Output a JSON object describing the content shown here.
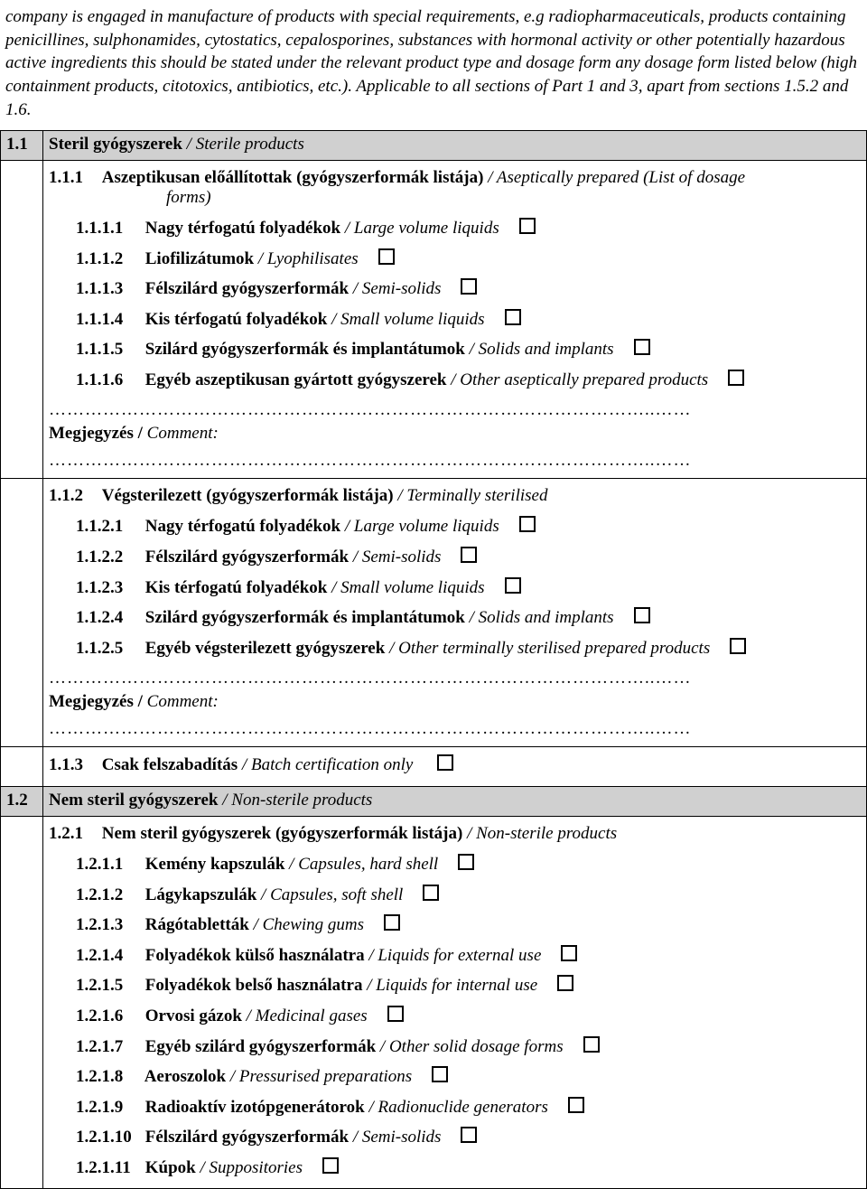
{
  "intro": "company is engaged in manufacture of products with special requirements, e.g radiopharmaceuticals, products containing penicillines, sulphonamides, cytostatics, cepalosporines, substances with hormonal activity or other potentially hazardous active ingredients this should be stated under the relevant product type and dosage form any dosage form listed below (high containment products, citotoxics, antibiotics, etc.). Applicable to all sections of Part 1 and 3, apart from sections 1.5.2 and 1.6.",
  "dots": "………………………………………………………………………………………..……",
  "comment": {
    "hu": "Megjegyzés",
    "sep": " / ",
    "en": "Comment:"
  },
  "s11": {
    "num": "1.1",
    "title_hu": "Steril gyógyszerek",
    "title_en": "Sterile products",
    "sep": " / ",
    "g111": {
      "num": "1.1.1",
      "title_hu": "Aszeptikusan előállítottak (gyógyszerformák listája)",
      "title_en_a": "Aseptically prepared (List of dosage",
      "title_en_b": "forms)",
      "items": [
        {
          "n": "1.1.1.1",
          "hu": "Nagy térfogatú folyadékok",
          "en": "Large volume liquids"
        },
        {
          "n": "1.1.1.2",
          "hu": "Liofilizátumok",
          "en": "Lyophilisates"
        },
        {
          "n": "1.1.1.3",
          "hu": "Félszilárd gyógyszerformák",
          "en": "Semi-solids"
        },
        {
          "n": "1.1.1.4",
          "hu": "Kis térfogatú folyadékok",
          "en": "Small volume liquids"
        },
        {
          "n": "1.1.1.5",
          "hu": "Szilárd gyógyszerformák és implantátumok",
          "en": "Solids and implants"
        },
        {
          "n": "1.1.1.6",
          "hu": "Egyéb aszeptikusan gyártott gyógyszerek",
          "en": "Other aseptically prepared products"
        }
      ]
    },
    "g112": {
      "num": "1.1.2",
      "title_hu": "Végsterilezett (gyógyszerformák listája)",
      "title_en": "Terminally sterilised",
      "items": [
        {
          "n": "1.1.2.1",
          "hu": "Nagy térfogatú folyadékok",
          "en": "Large volume liquids"
        },
        {
          "n": "1.1.2.2",
          "hu": "Félszilárd gyógyszerformák",
          "en": "Semi-solids"
        },
        {
          "n": "1.1.2.3",
          "hu": "Kis térfogatú folyadékok",
          "en": "Small volume liquids"
        },
        {
          "n": "1.1.2.4",
          "hu": "Szilárd gyógyszerformák és implantátumok",
          "en": "Solids and implants"
        },
        {
          "n": "1.1.2.5",
          "hu": "Egyéb végsterilezett gyógyszerek",
          "en": "Other terminally sterilised prepared products"
        }
      ]
    },
    "g113": {
      "num": "1.1.3",
      "title_hu": "Csak felszabadítás",
      "title_en": "Batch certification only"
    }
  },
  "s12": {
    "num": "1.2",
    "title_hu": "Nem steril gyógyszerek",
    "title_en": "Non-sterile products",
    "sep": " / ",
    "g121": {
      "num": "1.2.1",
      "title_hu": "Nem steril gyógyszerek (gyógyszerformák listája)",
      "title_en": "Non-sterile products",
      "items": [
        {
          "n": "1.2.1.1",
          "hu": "Kemény kapszulák",
          "en": "Capsules, hard shell"
        },
        {
          "n": "1.2.1.2",
          "hu": "Lágykapszulák",
          "en": "Capsules, soft shell"
        },
        {
          "n": "1.2.1.3",
          "hu": "Rágótabletták",
          "en": "Chewing gums"
        },
        {
          "n": "1.2.1.4",
          "hu": "Folyadékok külső használatra",
          "en": "Liquids for external use"
        },
        {
          "n": "1.2.1.5",
          "hu": "Folyadékok belső használatra",
          "en": "Liquids for internal use"
        },
        {
          "n": "1.2.1.6",
          "hu": "Orvosi gázok",
          "en": "Medicinal gases"
        },
        {
          "n": "1.2.1.7",
          "hu": "Egyéb szilárd gyógyszerformák",
          "en": "Other solid dosage forms"
        },
        {
          "n": "1.2.1.8",
          "hu": "Aeroszolok",
          "en": "Pressurised preparations"
        },
        {
          "n": "1.2.1.9",
          "hu": "Radioaktív izotópgenerátorok",
          "en": "Radionuclide generators"
        },
        {
          "n": "1.2.1.10",
          "hu": "Félszilárd gyógyszerformák",
          "en": "Semi-solids"
        },
        {
          "n": "1.2.1.11",
          "hu": "Kúpok",
          "en": "Suppositories"
        }
      ]
    }
  }
}
